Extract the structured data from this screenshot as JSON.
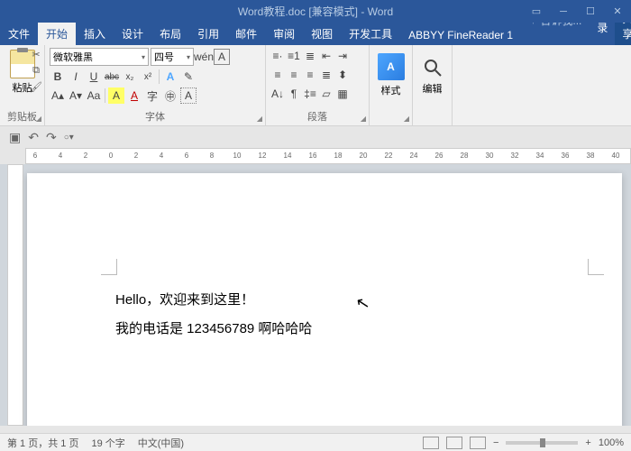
{
  "title_bar": {
    "title": "Word教程.doc [兼容模式] - Word"
  },
  "tabs": {
    "items": [
      "文件",
      "开始",
      "插入",
      "设计",
      "布局",
      "引用",
      "邮件",
      "审阅",
      "视图",
      "开发工具",
      "ABBYY FineReader 1"
    ],
    "active_index": 1,
    "tell_me": "告诉我...",
    "signin": "登录",
    "share": "共享"
  },
  "ribbon": {
    "clipboard": {
      "paste": "粘贴",
      "label": "剪贴板"
    },
    "font": {
      "name": "微软雅黑",
      "size": "四号",
      "bold": "B",
      "italic": "I",
      "underline": "U",
      "strike": "abc",
      "sub": "x₂",
      "sup": "x²",
      "phonetic": "wén",
      "charborder": "A",
      "label": "字体"
    },
    "para": {
      "label": "段落"
    },
    "style": {
      "btn": "样式",
      "icon": "A"
    },
    "edit": {
      "btn": "编辑"
    }
  },
  "ruler": {
    "ticks": [
      -6,
      -4,
      -2,
      0,
      2,
      4,
      6,
      8,
      10,
      12,
      14,
      16,
      18,
      20,
      22,
      24,
      26,
      28,
      30,
      32,
      34,
      36,
      38,
      40
    ]
  },
  "document": {
    "line1": "Hello，欢迎来到这里！",
    "line2": "我的电话是 123456789 啊哈哈哈"
  },
  "status": {
    "page": "第 1 页，共 1 页",
    "words": "19 个字",
    "lang": "中文(中国)",
    "zoom": "100%"
  }
}
